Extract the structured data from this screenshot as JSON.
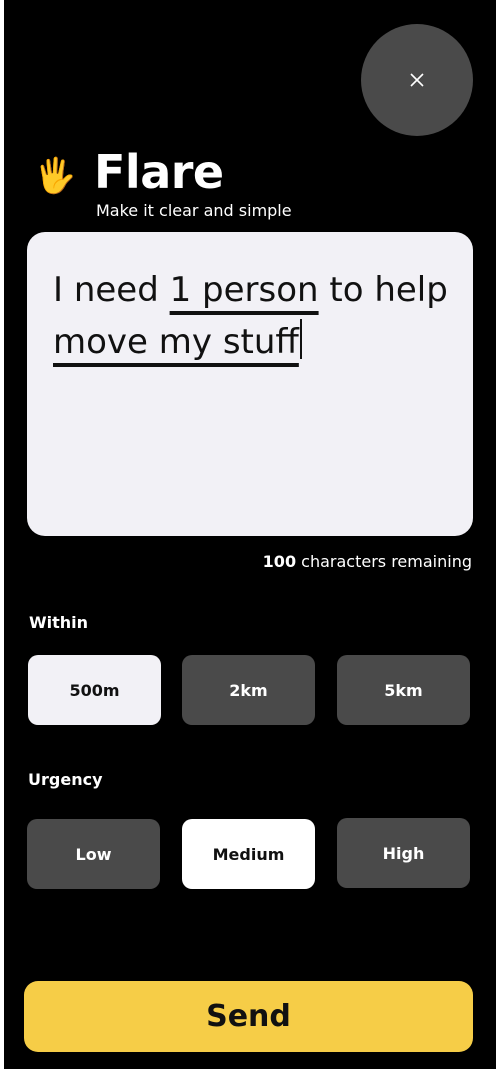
{
  "header": {
    "close_icon": "close-x-icon",
    "logo_icon": "raised-hand-emoji",
    "logo_emoji": "🖐",
    "title": "Flare",
    "subtitle": "Make it clear and simple"
  },
  "message": {
    "parts": [
      "I need ",
      "1 person",
      " to help ",
      "move my stuff"
    ],
    "underlined": [
      "1 person",
      "move my stuff"
    ]
  },
  "counter": {
    "count": "100",
    "text": " characters remaining"
  },
  "within": {
    "label": "Within",
    "options": [
      "500m",
      "2km",
      "5km"
    ],
    "selected": "500m"
  },
  "urgency": {
    "label": "Urgency",
    "options": [
      "Low",
      "Medium",
      "High"
    ],
    "selected": "Medium"
  },
  "send_label": "Send",
  "colors": {
    "background": "#000000",
    "accent": "#f6cd47",
    "button": "#4a4a4a",
    "selected": "#f2f1f6"
  }
}
